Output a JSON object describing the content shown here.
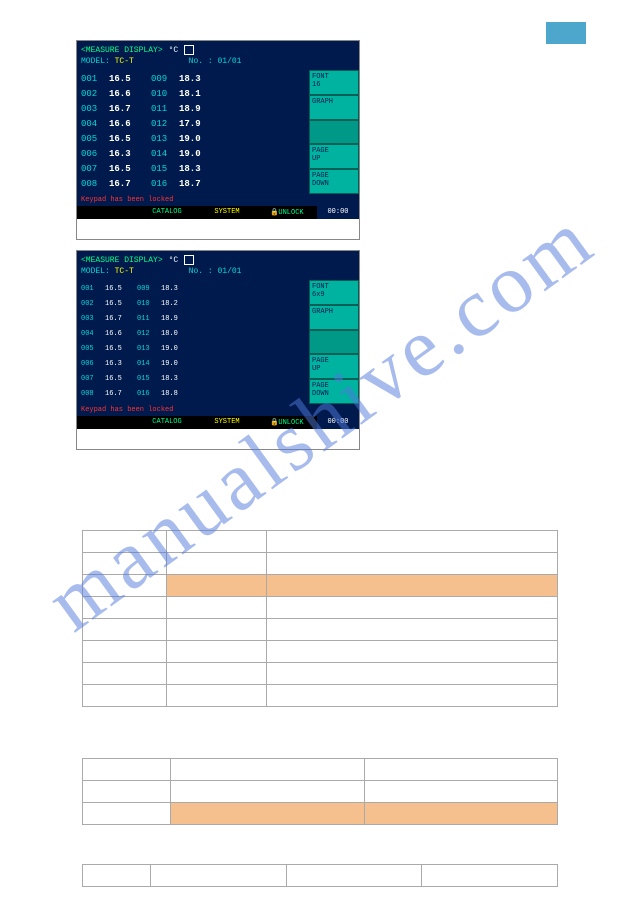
{
  "pageTab": "",
  "watermark": "manualshive.com",
  "device1": {
    "title": "<MEASURE DISPLAY>",
    "unit": "°C",
    "modelLabel": "MODEL:",
    "modelValue": "TC-T",
    "noLabel": "No. :",
    "page": "01/01",
    "rows": [
      {
        "c1": "001",
        "v1": "16.5",
        "c2": "009",
        "v2": "18.3"
      },
      {
        "c1": "002",
        "v1": "16.6",
        "c2": "010",
        "v2": "18.1"
      },
      {
        "c1": "003",
        "v1": "16.7",
        "c2": "011",
        "v2": "18.9"
      },
      {
        "c1": "004",
        "v1": "16.6",
        "c2": "012",
        "v2": "17.9"
      },
      {
        "c1": "005",
        "v1": "16.5",
        "c2": "013",
        "v2": "19.0"
      },
      {
        "c1": "006",
        "v1": "16.3",
        "c2": "014",
        "v2": "19.0"
      },
      {
        "c1": "007",
        "v1": "16.5",
        "c2": "015",
        "v2": "18.3"
      },
      {
        "c1": "008",
        "v1": "16.7",
        "c2": "016",
        "v2": "18.7"
      }
    ],
    "side": [
      "FONT\n16",
      "GRAPH",
      "",
      "PAGE\nUP",
      "PAGE\nDOWN"
    ],
    "msg": "Keypad has been locked",
    "status": {
      "catalog": "CATALOG",
      "system": "SYSTEM",
      "unlock": "UNLOCK",
      "time": "00:00"
    }
  },
  "device2": {
    "title": "<MEASURE DISPLAY>",
    "unit": "°C",
    "modelLabel": "MODEL:",
    "modelValue": "TC-T",
    "noLabel": "No. :",
    "page": "01/01",
    "rows": [
      {
        "c1": "001",
        "v1": "16.5",
        "c2": "009",
        "v2": "18.3"
      },
      {
        "c1": "002",
        "v1": "16.5",
        "c2": "010",
        "v2": "18.2"
      },
      {
        "c1": "003",
        "v1": "16.7",
        "c2": "011",
        "v2": "18.9"
      },
      {
        "c1": "004",
        "v1": "16.6",
        "c2": "012",
        "v2": "18.0"
      },
      {
        "c1": "005",
        "v1": "16.5",
        "c2": "013",
        "v2": "19.0"
      },
      {
        "c1": "006",
        "v1": "16.3",
        "c2": "014",
        "v2": "19.0"
      },
      {
        "c1": "007",
        "v1": "16.5",
        "c2": "015",
        "v2": "18.3"
      },
      {
        "c1": "008",
        "v1": "16.7",
        "c2": "016",
        "v2": "18.8"
      }
    ],
    "side": [
      "FONT\n6x9",
      "GRAPH",
      "",
      "PAGE\nUP",
      "PAGE\nDOWN"
    ],
    "msg": "Keypad has been locked",
    "status": {
      "catalog": "CATALOG",
      "system": "SYSTEM",
      "unlock": "UNLOCK",
      "time": "00:00"
    }
  },
  "table1": {
    "rows": 8,
    "cols": 3,
    "hlRow": 2,
    "hlCols": [
      1,
      2
    ]
  },
  "table2": {
    "rows": 3,
    "cols": 3,
    "hlRow": 2,
    "hlCols": [
      1,
      2
    ]
  },
  "table3": {
    "rows": 1,
    "cols": 4
  }
}
